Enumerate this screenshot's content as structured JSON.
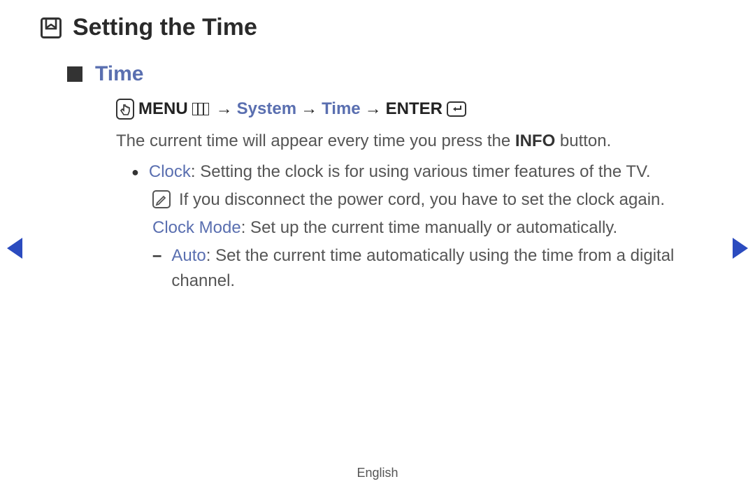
{
  "page": {
    "title": "Setting the Time",
    "section": "Time",
    "footer": "English"
  },
  "breadcrumb": {
    "menu": "MENU",
    "arrow1": "→",
    "system": "System",
    "arrow2": "→",
    "time": "Time",
    "arrow3": "→",
    "enter": "ENTER"
  },
  "body": {
    "intro_pre": "The current time will appear every time you press the ",
    "intro_bold": "INFO",
    "intro_post": " button.",
    "clock_label": "Clock",
    "clock_desc": ": Setting the clock is for using various timer features of the TV.",
    "note": "If you disconnect the power cord, you have to set the clock again.",
    "clockmode_label": "Clock Mode",
    "clockmode_desc": ": Set up the current time manually or automatically.",
    "auto_label": "Auto",
    "auto_desc": ": Set the current time automatically using the time from a digital channel."
  }
}
